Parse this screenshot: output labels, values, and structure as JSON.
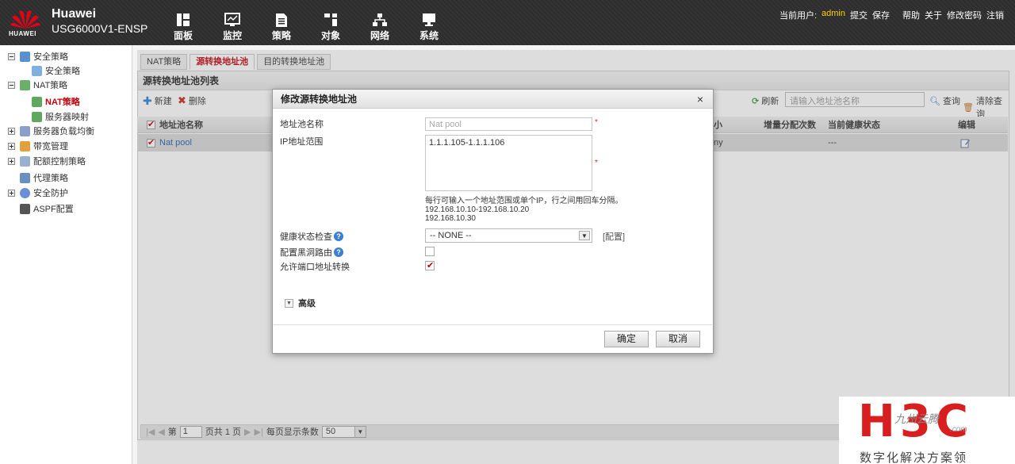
{
  "header": {
    "logo_text": "HUAWEI",
    "brand": "Huawei",
    "model": "USG6000V1-ENSP",
    "nav": [
      {
        "label": "面板",
        "icon": "dashboard-icon"
      },
      {
        "label": "监控",
        "icon": "monitor-icon"
      },
      {
        "label": "策略",
        "icon": "policy-icon"
      },
      {
        "label": "对象",
        "icon": "object-icon"
      },
      {
        "label": "网络",
        "icon": "network-icon"
      },
      {
        "label": "系统",
        "icon": "system-icon"
      }
    ],
    "user_prefix": "当前用户:",
    "user": "admin",
    "links": [
      "提交",
      "保存",
      "帮助",
      "关于",
      "修改密码",
      "注销"
    ]
  },
  "sidebar": {
    "items": [
      {
        "label": "安全策略"
      },
      {
        "label": "安全策略"
      },
      {
        "label": "NAT策略"
      },
      {
        "label": "NAT策略"
      },
      {
        "label": "服务器映射"
      },
      {
        "label": "服务器负载均衡"
      },
      {
        "label": "带宽管理"
      },
      {
        "label": "配额控制策略"
      },
      {
        "label": "代理策略"
      },
      {
        "label": "安全防护"
      },
      {
        "label": "ASPF配置"
      }
    ]
  },
  "content": {
    "tabs": [
      "NAT策略",
      "源转换地址池",
      "目的转换地址池"
    ],
    "active_tab": "源转换地址池",
    "panel_title": "源转换地址池列表",
    "toolbar": {
      "new": "新建",
      "delete": "删除",
      "refresh": "刷新",
      "search_placeholder": "请输入地址池名称",
      "query": "查询",
      "clear": "清除查询"
    },
    "columns": [
      "地址池名称",
      "小",
      "增量分配次数",
      "当前健康状态",
      "编辑"
    ],
    "rows": [
      {
        "name": "Nat pool",
        "size": "ny",
        "health": "---"
      }
    ],
    "pager": {
      "page_label": "第",
      "page": "1",
      "total": "页共 1 页",
      "per_page_label": "每页显示条数",
      "per_page": "50"
    }
  },
  "modal": {
    "title": "修改源转换地址池",
    "close": "×",
    "name_label": "地址池名称",
    "name_value": "Nat pool",
    "range_label": "IP地址范围",
    "range_value": "1.1.1.105-1.1.1.106",
    "hint_lines": [
      "每行可输入一个地址范围或单个IP，行之间用回车分隔。",
      "192.168.10.10-192.168.10.20",
      "192.168.10.30"
    ],
    "health_label": "健康状态检查",
    "health_value": "-- NONE --",
    "config_link": "[配置]",
    "blackhole_label": "配置黑洞路由",
    "port_label": "允许端口地址转换",
    "blackhole_checked": false,
    "port_checked": true,
    "advanced": "高级",
    "ok": "确定",
    "cancel": "取消",
    "required_mark": "*"
  },
  "watermark": {
    "big": "H3C",
    "mid": "九州云腾",
    "com": ".com",
    "sub": "数字化解决方案领"
  },
  "colors": {
    "accent": "#c2000b",
    "header_bg": "#2d2d2d",
    "user": "#ffd000"
  }
}
